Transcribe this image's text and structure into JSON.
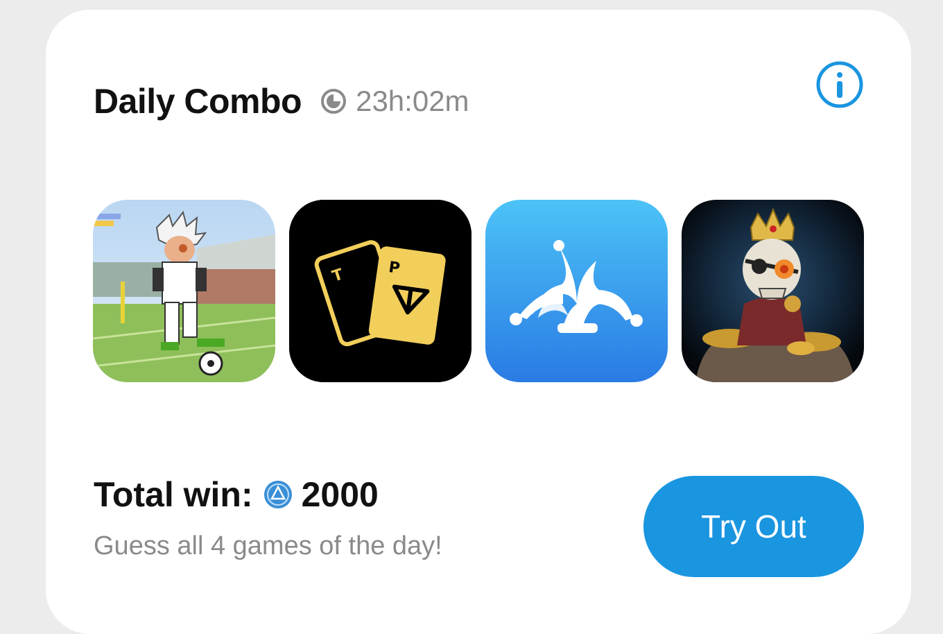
{
  "card": {
    "title": "Daily Combo",
    "timer": "23h:02m",
    "timer_icon": "clock-icon",
    "info_icon": "info-icon"
  },
  "games": [
    {
      "name": "soccer-game-icon"
    },
    {
      "name": "tp-cards-game-icon"
    },
    {
      "name": "jester-hat-game-icon"
    },
    {
      "name": "skeleton-king-game-icon"
    }
  ],
  "reward": {
    "label": "Total win:",
    "coin_icon": "coin-icon",
    "amount": "2000",
    "subtitle": "Guess all 4 games of the day!"
  },
  "cta": {
    "label": "Try Out"
  },
  "colors": {
    "accent": "#1a95e0",
    "muted_text": "#8a8a8a",
    "primary_text": "#111111"
  }
}
